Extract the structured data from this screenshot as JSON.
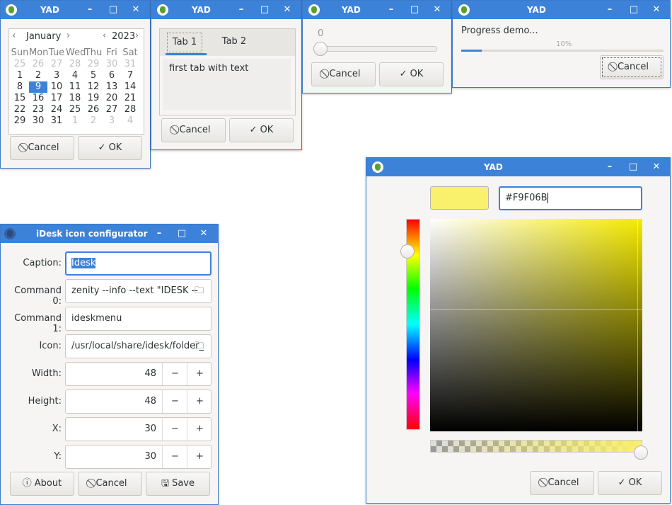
{
  "colors": {
    "titlebar": "#3c82d9",
    "accent": "#3c82d9",
    "swatch": "#F9F06B"
  },
  "window_controls": {
    "minimize": "–",
    "maximize": "□",
    "close": "✕"
  },
  "buttons": {
    "cancel": "Cancel",
    "ok": "OK",
    "about": "About",
    "save": "Save"
  },
  "calendar": {
    "title": "YAD",
    "month": "January",
    "year": "2023",
    "selected_day": "9",
    "weekdays": [
      "Sun",
      "Mon",
      "Tue",
      "Wed",
      "Thu",
      "Fri",
      "Sat"
    ],
    "rows": [
      [
        "25",
        "26",
        "27",
        "28",
        "29",
        "30",
        "31"
      ],
      [
        "1",
        "2",
        "3",
        "4",
        "5",
        "6",
        "7"
      ],
      [
        "8",
        "9",
        "10",
        "11",
        "12",
        "13",
        "14"
      ],
      [
        "15",
        "16",
        "17",
        "18",
        "19",
        "20",
        "21"
      ],
      [
        "22",
        "23",
        "24",
        "25",
        "26",
        "27",
        "28"
      ],
      [
        "29",
        "30",
        "31",
        "1",
        "2",
        "3",
        "4"
      ]
    ]
  },
  "tabs": {
    "title": "YAD",
    "tab1": "Tab 1",
    "tab2": "Tab 2",
    "content": "first tab with text"
  },
  "scale": {
    "title": "YAD",
    "value": "0"
  },
  "progress": {
    "title": "YAD",
    "text": "Progress demo...",
    "percent_label": "10%",
    "fraction": 0.1
  },
  "color_dialog": {
    "title": "YAD",
    "hex": "#F9F06B"
  },
  "idesk": {
    "title": "iDesk icon configurator",
    "caption_label": "Caption:",
    "caption_value": "Idesk",
    "cmd0_label": "Command 0:",
    "cmd0_value": "zenity --info --text \"IDESK --",
    "cmd1_label": "Command 1:",
    "cmd1_value": "ideskmenu",
    "icon_label": "Icon:",
    "icon_value": "/usr/local/share/idesk/folder_",
    "width_label": "Width:",
    "width_value": "48",
    "height_label": "Height:",
    "height_value": "48",
    "x_label": "X:",
    "x_value": "30",
    "y_label": "Y:",
    "y_value": "30"
  }
}
